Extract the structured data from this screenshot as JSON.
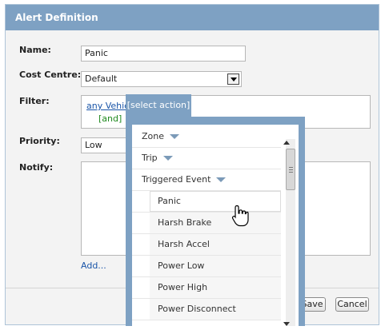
{
  "dialog": {
    "title": "Alert Definition"
  },
  "form": {
    "name_label": "Name:",
    "name_value": "Panic",
    "cost_centre_label": "Cost Centre:",
    "cost_centre_value": "Default",
    "filter_label": "Filter:",
    "filter_link": "any Vehicle",
    "filter_and": "[and]",
    "priority_label": "Priority:",
    "priority_value": "Low",
    "notify_label": "Notify:",
    "add_link": "Add..."
  },
  "popup": {
    "tab_label": "[select action]",
    "items": [
      {
        "label": "Zone",
        "kind": "category"
      },
      {
        "label": "Trip",
        "kind": "category"
      },
      {
        "label": "Triggered Event",
        "kind": "category"
      },
      {
        "label": "Panic",
        "kind": "event"
      },
      {
        "label": "Harsh Brake",
        "kind": "event"
      },
      {
        "label": "Harsh Accel",
        "kind": "event"
      },
      {
        "label": "Power Low",
        "kind": "event"
      },
      {
        "label": "Power High",
        "kind": "event"
      },
      {
        "label": "Power Disconnect",
        "kind": "event"
      }
    ]
  },
  "buttons": {
    "save": "Save",
    "cancel": "Cancel"
  },
  "colors": {
    "titlebar": "#7ea1c3",
    "link": "#1a55a8",
    "and": "#1f8a1f"
  }
}
